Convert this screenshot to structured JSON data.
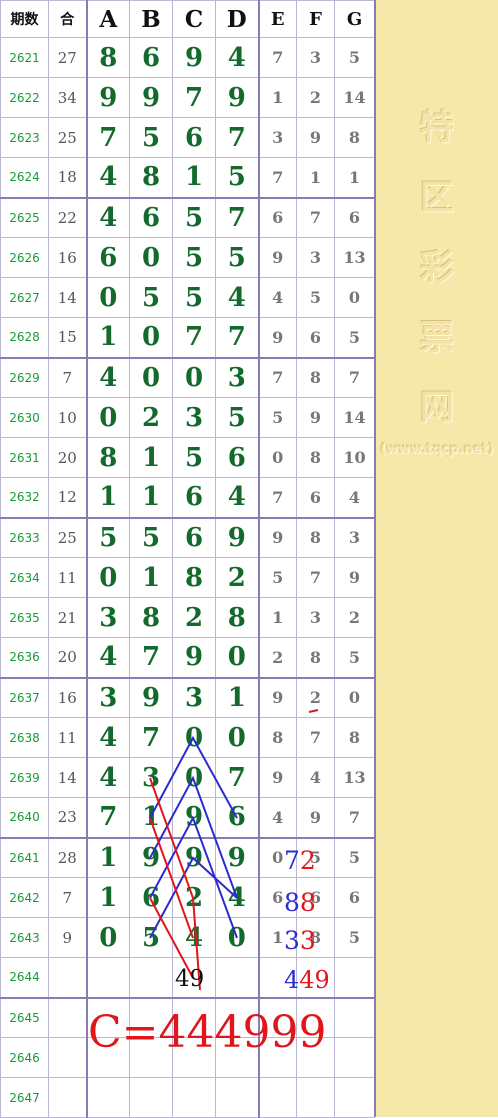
{
  "headers": [
    "期数",
    "合",
    "A",
    "B",
    "C",
    "D",
    "E",
    "F",
    "G"
  ],
  "rows": [
    {
      "period": "2621",
      "sum": "27",
      "a": "8",
      "b": "6",
      "c": "9",
      "d": "4",
      "e": "7",
      "f": "3",
      "g": "5"
    },
    {
      "period": "2622",
      "sum": "34",
      "a": "9",
      "b": "9",
      "c": "7",
      "d": "9",
      "e": "1",
      "f": "2",
      "g": "14"
    },
    {
      "period": "2623",
      "sum": "25",
      "a": "7",
      "b": "5",
      "c": "6",
      "d": "7",
      "e": "3",
      "f": "9",
      "g": "8"
    },
    {
      "period": "2624",
      "sum": "18",
      "a": "4",
      "b": "8",
      "c": "1",
      "d": "5",
      "e": "7",
      "f": "1",
      "g": "1"
    },
    {
      "period": "2625",
      "sum": "22",
      "a": "4",
      "b": "6",
      "c": "5",
      "d": "7",
      "e": "6",
      "f": "7",
      "g": "6"
    },
    {
      "period": "2626",
      "sum": "16",
      "a": "6",
      "b": "0",
      "c": "5",
      "d": "5",
      "e": "9",
      "f": "3",
      "g": "13"
    },
    {
      "period": "2627",
      "sum": "14",
      "a": "0",
      "b": "5",
      "c": "5",
      "d": "4",
      "e": "4",
      "f": "5",
      "g": "0"
    },
    {
      "period": "2628",
      "sum": "15",
      "a": "1",
      "b": "0",
      "c": "7",
      "d": "7",
      "e": "9",
      "f": "6",
      "g": "5"
    },
    {
      "period": "2629",
      "sum": "7",
      "a": "4",
      "b": "0",
      "c": "0",
      "d": "3",
      "e": "7",
      "f": "8",
      "g": "7"
    },
    {
      "period": "2630",
      "sum": "10",
      "a": "0",
      "b": "2",
      "c": "3",
      "d": "5",
      "e": "5",
      "f": "9",
      "g": "14"
    },
    {
      "period": "2631",
      "sum": "20",
      "a": "8",
      "b": "1",
      "c": "5",
      "d": "6",
      "e": "0",
      "f": "8",
      "g": "10"
    },
    {
      "period": "2632",
      "sum": "12",
      "a": "1",
      "b": "1",
      "c": "6",
      "d": "4",
      "e": "7",
      "f": "6",
      "g": "4"
    },
    {
      "period": "2633",
      "sum": "25",
      "a": "5",
      "b": "5",
      "c": "6",
      "d": "9",
      "e": "9",
      "f": "8",
      "g": "3"
    },
    {
      "period": "2634",
      "sum": "11",
      "a": "0",
      "b": "1",
      "c": "8",
      "d": "2",
      "e": "5",
      "f": "7",
      "g": "9"
    },
    {
      "period": "2635",
      "sum": "21",
      "a": "3",
      "b": "8",
      "c": "2",
      "d": "8",
      "e": "1",
      "f": "3",
      "g": "2"
    },
    {
      "period": "2636",
      "sum": "20",
      "a": "4",
      "b": "7",
      "c": "9",
      "d": "0",
      "e": "2",
      "f": "8",
      "g": "5"
    },
    {
      "period": "2637",
      "sum": "16",
      "a": "3",
      "b": "9",
      "c": "3",
      "d": "1",
      "e": "9",
      "f": "2",
      "g": "0"
    },
    {
      "period": "2638",
      "sum": "11",
      "a": "4",
      "b": "7",
      "c": "0",
      "d": "0",
      "e": "8",
      "f": "7",
      "g": "8"
    },
    {
      "period": "2639",
      "sum": "14",
      "a": "4",
      "b": "3",
      "c": "0",
      "d": "7",
      "e": "9",
      "f": "4",
      "g": "13"
    },
    {
      "period": "2640",
      "sum": "23",
      "a": "7",
      "b": "1",
      "c": "9",
      "d": "6",
      "e": "4",
      "f": "9",
      "g": "7"
    },
    {
      "period": "2641",
      "sum": "28",
      "a": "1",
      "b": "9",
      "c": "9",
      "d": "9",
      "e": "0",
      "f": "5",
      "g": "5"
    },
    {
      "period": "2642",
      "sum": "7",
      "a": "1",
      "b": "6",
      "c": "2",
      "d": "4",
      "e": "6",
      "f": "6",
      "g": "6"
    },
    {
      "period": "2643",
      "sum": "9",
      "a": "0",
      "b": "5",
      "c": "4",
      "d": "0",
      "e": "1",
      "f": "8",
      "g": "5"
    },
    {
      "period": "2644",
      "sum": "",
      "a": "",
      "b": "",
      "c": "",
      "d": "",
      "e": "",
      "f": "",
      "g": ""
    },
    {
      "period": "2645",
      "sum": "",
      "a": "",
      "b": "",
      "c": "",
      "d": "",
      "e": "",
      "f": "",
      "g": ""
    },
    {
      "period": "2646",
      "sum": "",
      "a": "",
      "b": "",
      "c": "",
      "d": "",
      "e": "",
      "f": "",
      "g": ""
    },
    {
      "period": "2647",
      "sum": "",
      "a": "",
      "b": "",
      "c": "",
      "d": "",
      "e": "",
      "f": "",
      "g": ""
    }
  ],
  "annotations": {
    "sum_note": "49",
    "note_72_a": "7",
    "note_72_b": "2",
    "note_88_a": "8",
    "note_88_b": "8",
    "note_33_a": "3",
    "note_33_b": "3",
    "note_449_a": "4",
    "note_449_b": "49",
    "prediction": "C=444999"
  },
  "watermark": {
    "chars": [
      "特",
      "区",
      "彩",
      "票",
      "网"
    ],
    "url": "(www.tqcp.net)"
  },
  "colors": {
    "digit_green": "#136a2c",
    "period_green": "#1a9a3a",
    "line_blue": "#2b2bd0",
    "line_red": "#e0161a",
    "banner_bg": "#f6e8a8",
    "border": "#8a7ab8"
  }
}
